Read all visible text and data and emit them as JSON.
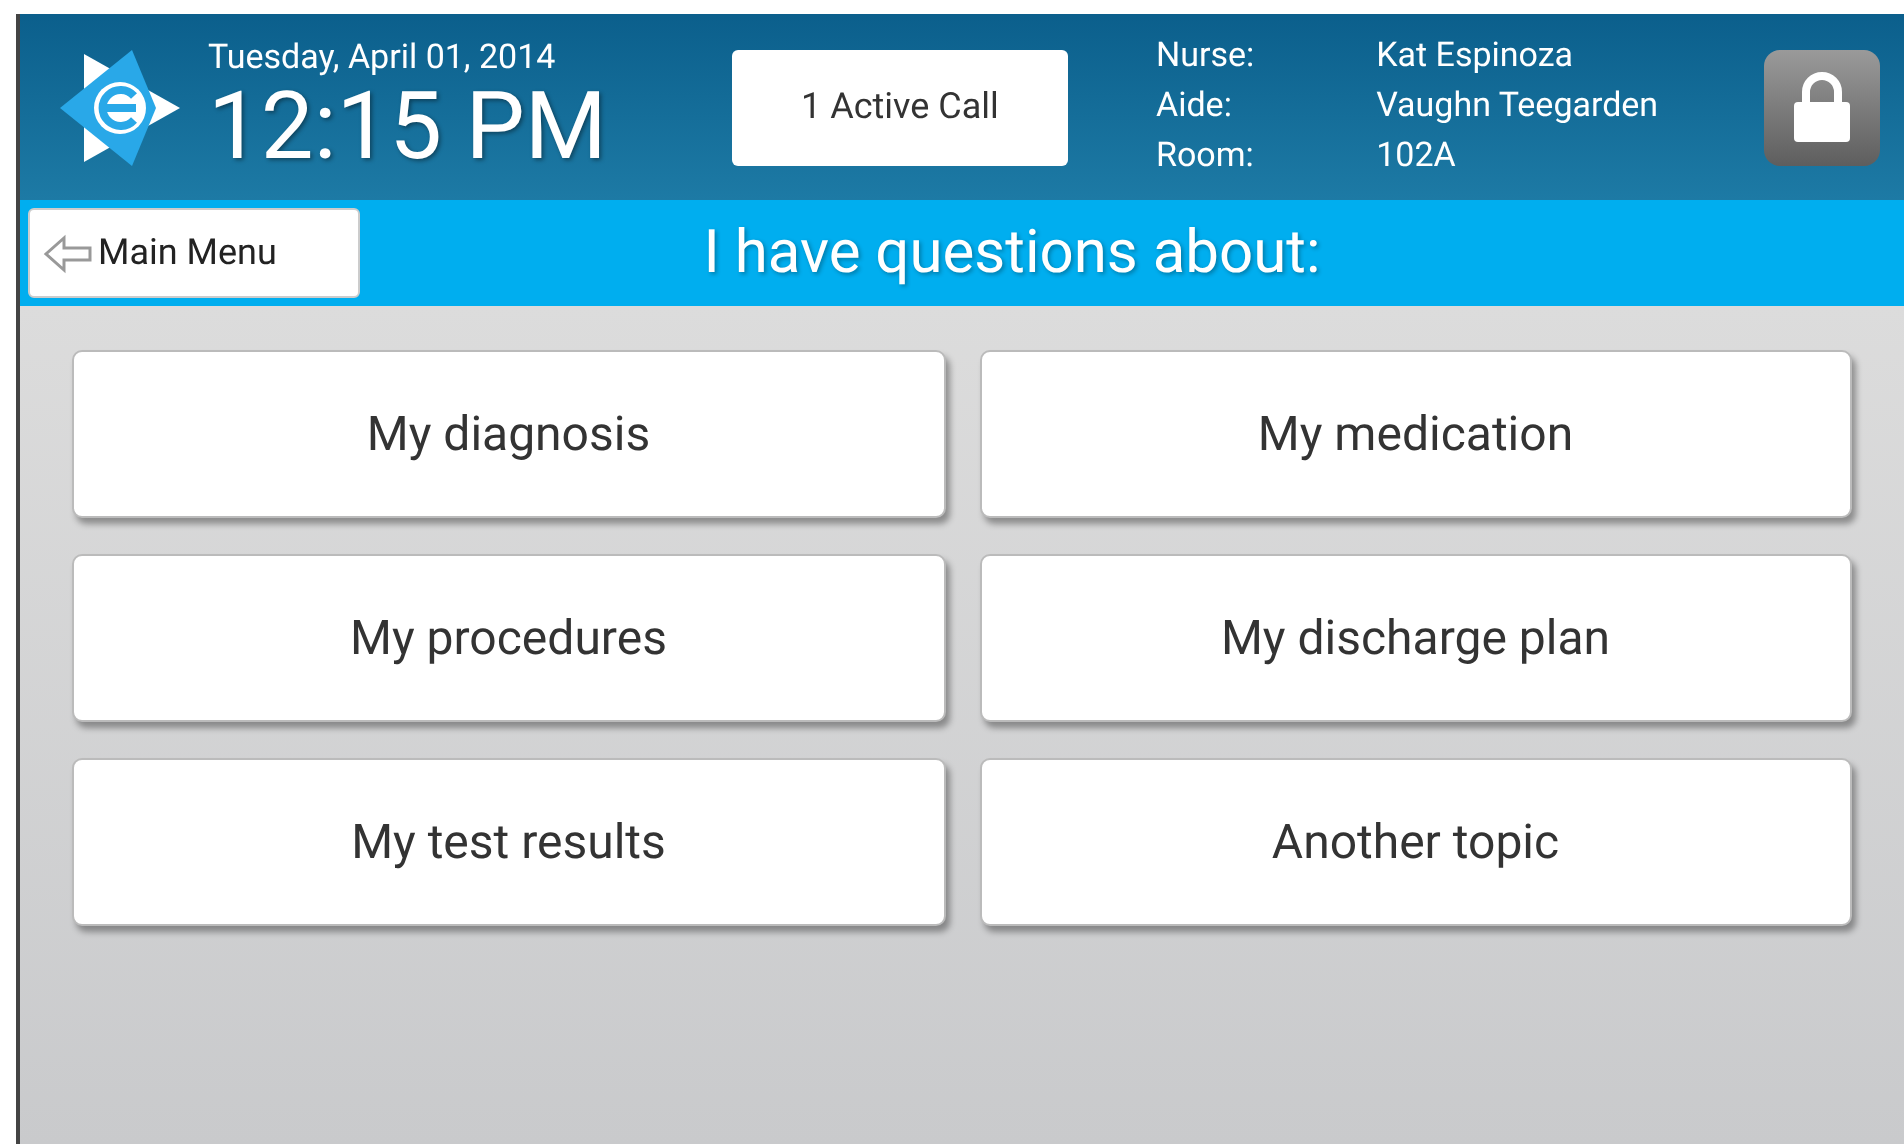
{
  "header": {
    "date": "Tuesday, April 01, 2014",
    "time": "12:15 PM",
    "call_button": "1 Active Call",
    "staff": [
      {
        "label": "Nurse:",
        "value": "Kat Espinoza"
      },
      {
        "label": "Aide:",
        "value": "Vaughn Teegarden"
      },
      {
        "label": "Room:",
        "value": "102A"
      }
    ]
  },
  "subheader": {
    "back_button": "Main Menu",
    "title": "I have questions about:"
  },
  "topics": [
    "My diagnosis",
    "My medication",
    "My procedures",
    "My discharge plan",
    "My test results",
    "Another topic"
  ]
}
